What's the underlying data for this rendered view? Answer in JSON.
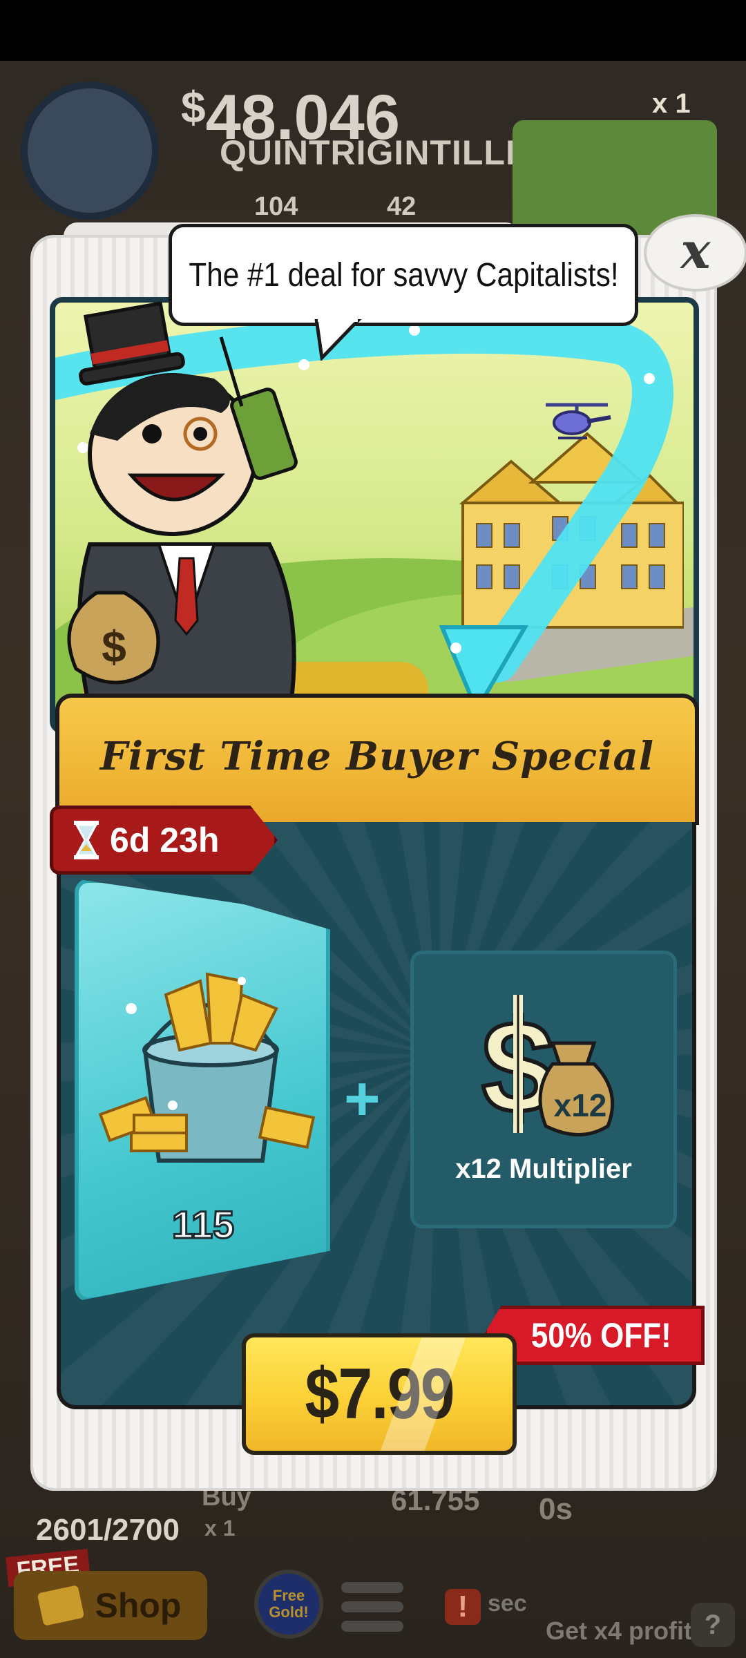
{
  "background": {
    "money_symbol": "$",
    "money_amount": "48.046",
    "money_unit": "QUINTRIGINTILLION",
    "stat_one": "104",
    "stat_two": "42",
    "manager_multiplier": "x 1",
    "business_count": "2601/2700",
    "buy_label": "Buy",
    "buy_amount": "x 1",
    "profit": "61.755",
    "time": "0s",
    "free_tag": "FREE",
    "shop_label": "Shop",
    "free_gold_label": "Free Gold!",
    "sec_label": "sec",
    "x4_profit_label": "Get x4 profit!"
  },
  "modal": {
    "speech": "The #1 deal for savvy Capitalists!",
    "close_glyph": "x",
    "title": "First Time Buyer Special",
    "timer": "6d 23h",
    "gold_amount": "115",
    "plus": "+",
    "multiplier_badge": "x12",
    "multiplier_label": "x12 Multiplier",
    "discount": "50% OFF!",
    "price": "$7.99"
  },
  "colors": {
    "panel": "#1e4b58",
    "banner": "#f0b636",
    "price_button": "#fbd035",
    "discount": "#d81a28",
    "timer": "#a81a1a",
    "gold_card": "#45c7d0"
  },
  "icons": {
    "hourglass": "hourglass-icon",
    "gold_bucket": "gold-bucket-icon",
    "multiplier": "dollar-moneybag-icon",
    "close": "close-icon"
  }
}
